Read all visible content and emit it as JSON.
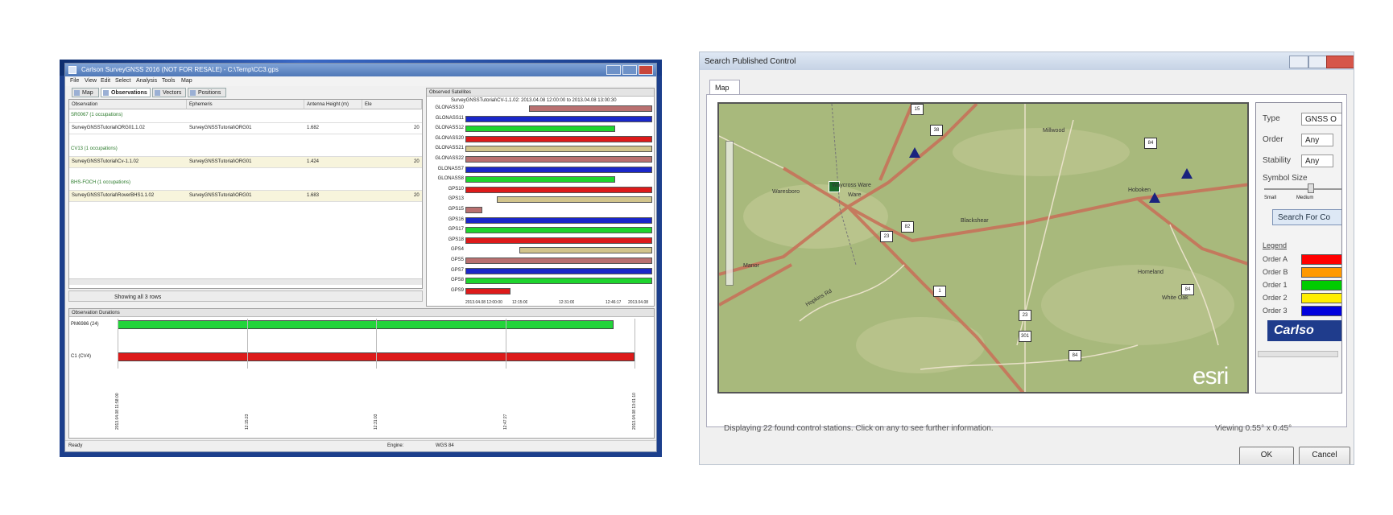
{
  "left_screenshot": {
    "window_title": "Carlson SurveyGNSS 2016 (NOT FOR RESALE) - C:\\Temp\\CC3.gps",
    "menu": [
      "File",
      "View",
      "Edit",
      "Select",
      "Analysis",
      "Tools",
      "Map"
    ],
    "tabs": [
      "Map",
      "Observations",
      "Vectors",
      "Positions"
    ],
    "table_headers": [
      "Observation",
      "Ephemeris",
      "Antenna Height (m)",
      "Ele"
    ],
    "groups": [
      {
        "title": "SR0067 (1 occupations)",
        "row": {
          "observation": "SurveyGNSSTutorial\\ORG01.1.02",
          "ephemeris": "SurveyGNSSTutorial\\ORG01",
          "height": "1.682",
          "extra": "20"
        }
      },
      {
        "title": "CV13 (1 occupations)",
        "row": {
          "observation": "SurveyGNSSTutorial\\Cv-1.1.02",
          "ephemeris": "SurveyGNSSTutorial\\ORG01",
          "height": "1.424",
          "extra": "20"
        }
      },
      {
        "title": "BHS-FOCH (1 occupations)",
        "row": {
          "observation": "SurveyGNSSTutorial\\RoverBHS1.1.02",
          "ephemeris": "SurveyGNSSTutorial\\ORG01",
          "height": "1.683",
          "extra": "20"
        }
      }
    ],
    "table_footer": "Showing all 3 rows",
    "satellite_panel_title": "Observed Satellites",
    "satellite_panel_subtitle": "SurveyGNSSTutorial\\CV-1.1.02: 2013.04.08 12:00:00 to 2013.04.08 13:00:30",
    "satellite_axis_ticks": [
      "2013.04.08 12:00:00",
      "12:15:00",
      "12:31:00",
      "12:46:17",
      "2013.04.08"
    ],
    "satellites": [
      {
        "name": "GLONASS10",
        "color": "#b97070",
        "start": 0.34,
        "end": 1.0
      },
      {
        "name": "GLONASS11",
        "color": "#1a27c9",
        "start": 0.0,
        "end": 1.0
      },
      {
        "name": "GLONASS12",
        "color": "#1ed42e",
        "start": 0.0,
        "end": 0.8
      },
      {
        "name": "GLONASS20",
        "color": "#dd1a1a",
        "start": 0.0,
        "end": 1.0
      },
      {
        "name": "GLONASS21",
        "color": "#d2c48c",
        "start": 0.0,
        "end": 1.0
      },
      {
        "name": "GLONASS22",
        "color": "#b97070",
        "start": 0.0,
        "end": 1.0
      },
      {
        "name": "GLONASS7",
        "color": "#1a27c9",
        "start": 0.0,
        "end": 1.0
      },
      {
        "name": "GLONASS8",
        "color": "#1ed42e",
        "start": 0.0,
        "end": 0.8
      },
      {
        "name": "GPS10",
        "color": "#dd1a1a",
        "start": 0.0,
        "end": 1.0
      },
      {
        "name": "GPS13",
        "color": "#d2c48c",
        "start": 0.17,
        "end": 1.0
      },
      {
        "name": "GPS15",
        "color": "#b97070",
        "start": 0.0,
        "end": 0.09
      },
      {
        "name": "GPS16",
        "color": "#1a27c9",
        "start": 0.0,
        "end": 1.0
      },
      {
        "name": "GPS17",
        "color": "#1ed42e",
        "start": 0.0,
        "end": 1.0
      },
      {
        "name": "GPS18",
        "color": "#dd1a1a",
        "start": 0.0,
        "end": 1.0
      },
      {
        "name": "GPS4",
        "color": "#d2c48c",
        "start": 0.29,
        "end": 1.0
      },
      {
        "name": "GPS5",
        "color": "#b97070",
        "start": 0.0,
        "end": 1.0
      },
      {
        "name": "GPS7",
        "color": "#1a27c9",
        "start": 0.0,
        "end": 1.0
      },
      {
        "name": "GPS8",
        "color": "#1ed42e",
        "start": 0.0,
        "end": 1.0
      },
      {
        "name": "GPS9",
        "color": "#dd1a1a",
        "start": 0.0,
        "end": 0.24
      }
    ],
    "duration_panel_title": "Observation Durations",
    "durations": [
      {
        "name": "PM6986 (24)",
        "color": "#22d43a",
        "start": 0.0,
        "end": 0.96
      },
      {
        "name": "C1 (CV4)",
        "color": "#dd1a1a",
        "start": 0.0,
        "end": 1.0
      }
    ],
    "duration_ticks": [
      "2013.04.08 11:58:00",
      "12:15:23",
      "12:31:03",
      "12:47:27",
      "2013.04.08 13:01:10"
    ],
    "status_left": "Ready",
    "status_mid_label": "Engine:",
    "status_mid_value": "WGS 84"
  },
  "right_screenshot": {
    "dialog_title": "Search Published Control",
    "tab_label": "Map",
    "map": {
      "places": [
        "Waycross Ware",
        "Ware",
        "Waresboro",
        "Manor",
        "Millwood",
        "Hoboken",
        "Blackshear",
        "Homeland",
        "White Oak"
      ],
      "shields": [
        "15",
        "38",
        "82",
        "23",
        "1",
        "84",
        "84",
        "23",
        "301",
        "84"
      ],
      "road_labels": [
        "Hopkins Rd"
      ],
      "watermark": "esri"
    },
    "side_panel": {
      "type_label": "Type",
      "type_value": "GNSS O",
      "order_label": "Order",
      "order_value": "Any",
      "stability_label": "Stability",
      "stability_value": "Any",
      "symbol_size_label": "Symbol Size",
      "slider_min": "Small",
      "slider_mid": "Medium",
      "search_button": "Search For Co",
      "legend_title": "Legend",
      "legend": [
        {
          "label": "Order A",
          "color": "#ff0000"
        },
        {
          "label": "Order B",
          "color": "#ff9900"
        },
        {
          "label": "Order 1",
          "color": "#00cc00"
        },
        {
          "label": "Order 2",
          "color": "#ffee00"
        },
        {
          "label": "Order 3",
          "color": "#0000dd"
        }
      ],
      "logo_text": "Carlso"
    },
    "status_text": "Displaying 22 found control stations. Click on any to see further information.",
    "viewing_text": "Viewing 0.55° x 0.45°",
    "ok_label": "OK",
    "cancel_label": "Cancel"
  }
}
